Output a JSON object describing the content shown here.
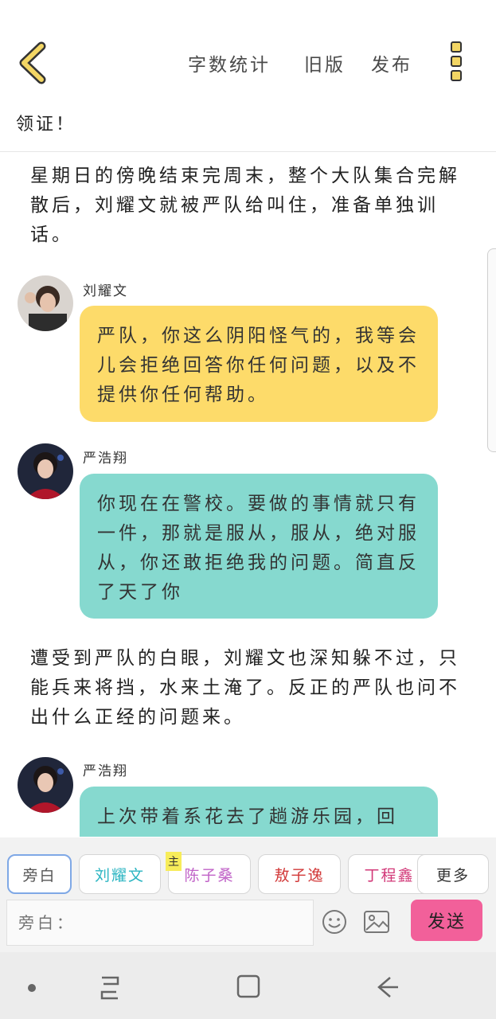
{
  "topbar": {
    "word_count": "字数统计",
    "old_version": "旧版",
    "publish": "发布"
  },
  "chapter_title": "领证！",
  "messages": [
    {
      "kind": "narration",
      "text": "星期日的傍晚结束完周末，整个大队集合完解散后，刘耀文就被严队给叫住，准备单独训话。"
    },
    {
      "kind": "dialog",
      "speaker": "刘耀文",
      "text": "严队，你这么阴阳怪气的，我等会儿会拒绝回答你任何问题，以及不提供你任何帮助。",
      "color": "#fddb6a"
    },
    {
      "kind": "dialog",
      "speaker": "严浩翔",
      "text": "你现在在警校。要做的事情就只有一件，那就是服从，服从，绝对服从，你还敢拒绝我的问题。简直反了天了你",
      "color": "#86d9cf"
    },
    {
      "kind": "narration",
      "text": "遭受到严队的白眼，刘耀文也深知躲不过，只能兵来将挡，水来土淹了。反正的严队也问不出什么正经的问题来。"
    },
    {
      "kind": "dialog",
      "speaker": "严浩翔",
      "text": "上次带着系花去了趟游乐园，回",
      "color": "#86d9cf"
    }
  ],
  "roles": [
    {
      "label": "旁白",
      "color": "#555555",
      "selected": true
    },
    {
      "label": "刘耀文",
      "color": "#2bb5c2",
      "selected": false
    },
    {
      "label": "陈子桑",
      "color": "#c062c7",
      "selected": false,
      "badge": "主"
    },
    {
      "label": "敖子逸",
      "color": "#d23838",
      "selected": false
    },
    {
      "label": "丁程鑫",
      "color": "#d23878",
      "selected": false
    }
  ],
  "more_label": "更多",
  "input": {
    "placeholder": "旁白："
  },
  "send_label": "发送"
}
